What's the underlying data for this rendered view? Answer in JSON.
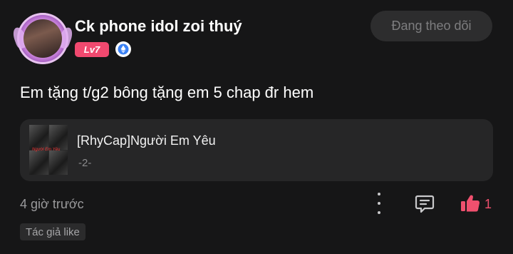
{
  "author": {
    "name": "Ck phone idol zoi thuý",
    "level": "Lv7",
    "badge_icon": "ethereum-diamond-icon",
    "avatar_icon": "avatar-image"
  },
  "follow": {
    "label": "Đang theo dõi"
  },
  "post": {
    "text": "Em tặng t/g2 bông tặng em 5 chap đr hem"
  },
  "card": {
    "title": "[RhyCap]Người Em Yêu",
    "subtitle": "-2-",
    "thumb_caption": "Người Em Yêu"
  },
  "footer": {
    "time": "4 giờ trước",
    "like_count": "1",
    "author_tag": "Tác giả like"
  },
  "colors": {
    "background": "#161617",
    "accent_pink": "#f0496f",
    "card_bg": "#262627",
    "muted_text": "#9a9a9c"
  }
}
